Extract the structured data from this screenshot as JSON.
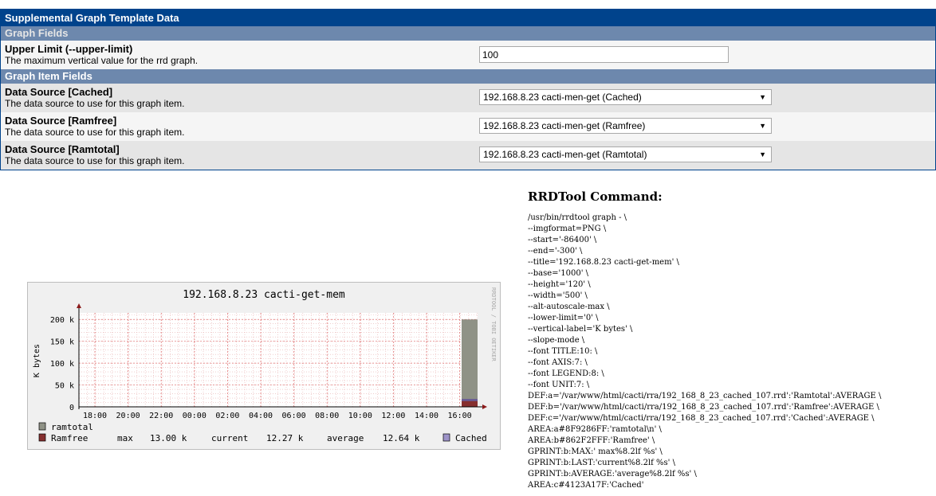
{
  "panel": {
    "title": "Supplemental Graph Template Data",
    "section_graph_fields": "Graph Fields",
    "upper_limit": {
      "label": "Upper Limit (--upper-limit)",
      "description": "The maximum vertical value for the rrd graph.",
      "value": "100"
    },
    "section_graph_items": "Graph Item Fields",
    "data_sources": [
      {
        "label": "Data Source [Cached]",
        "description": "The data source to use for this graph item.",
        "selected": "192.168.8.23 cacti-men-get (Cached)"
      },
      {
        "label": "Data Source [Ramfree]",
        "description": "The data source to use for this graph item.",
        "selected": "192.168.8.23 cacti-men-get (Ramfree)"
      },
      {
        "label": "Data Source [Ramtotal]",
        "description": "The data source to use for this graph item.",
        "selected": "192.168.8.23 cacti-men-get (Ramtotal)"
      }
    ]
  },
  "graph": {
    "watermark": "RRDTOOL / TOBI OETIKER"
  },
  "chart_data": {
    "type": "area",
    "title": "192.168.8.23 cacti-get-mem",
    "xlabel": "",
    "ylabel": "K bytes",
    "ylim": [
      0,
      215
    ],
    "xlim": [
      16.6,
      16.75
    ],
    "x_ticks": [
      "18:00",
      "20:00",
      "22:00",
      "00:00",
      "02:00",
      "04:00",
      "06:00",
      "08:00",
      "10:00",
      "12:00",
      "14:00",
      "16:00"
    ],
    "y_ticks": [
      "200 k",
      "150 k",
      "100 k",
      "50 k",
      "0"
    ],
    "y_tick_values": [
      200,
      150,
      100,
      50,
      0
    ],
    "grid": true,
    "series": [
      {
        "name": "ramtotal",
        "color": "#8F9286",
        "values": [
          200
        ]
      },
      {
        "name": "Ramfree",
        "color": "#862F2F",
        "values": [
          13
        ]
      },
      {
        "name": "Cached",
        "color": "#4123A1",
        "values": [
          18
        ]
      }
    ],
    "legend": {
      "ramtotal": "ramtotal",
      "ramfree": "Ramfree",
      "cached": "Cached",
      "max_label": "max",
      "max_value": "13.00 k",
      "current_label": "current",
      "current_value": "12.27 k",
      "average_label": "average",
      "average_value": "12.64 k"
    }
  },
  "command": {
    "title": "RRDTool Command:",
    "lines": [
      "/usr/bin/rrdtool graph - \\",
      "--imgformat=PNG \\",
      "--start='-86400' \\",
      "--end='-300' \\",
      "--title='192.168.8.23 cacti-get-mem' \\",
      "--base='1000' \\",
      "--height='120' \\",
      "--width='500' \\",
      "--alt-autoscale-max \\",
      "--lower-limit='0' \\",
      "--vertical-label='K bytes' \\",
      "--slope-mode \\",
      "--font TITLE:10: \\",
      "--font AXIS:7: \\",
      "--font LEGEND:8: \\",
      "--font UNIT:7: \\",
      "DEF:a='/var/www/html/cacti/rra/192_168_8_23_cached_107.rrd':'Ramtotal':AVERAGE \\",
      "DEF:b='/var/www/html/cacti/rra/192_168_8_23_cached_107.rrd':'Ramfree':AVERAGE \\",
      "DEF:c='/var/www/html/cacti/rra/192_168_8_23_cached_107.rrd':'Cached':AVERAGE \\",
      "AREA:a#8F9286FF:'ramtotal\\n' \\",
      "AREA:b#862F2FFF:'Ramfree' \\",
      "GPRINT:b:MAX:' max%8.2lf %s' \\",
      "GPRINT:b:LAST:'current%8.2lf %s' \\",
      "GPRINT:b:AVERAGE:'average%8.2lf %s' \\",
      "AREA:c#4123A17F:'Cached'"
    ]
  }
}
